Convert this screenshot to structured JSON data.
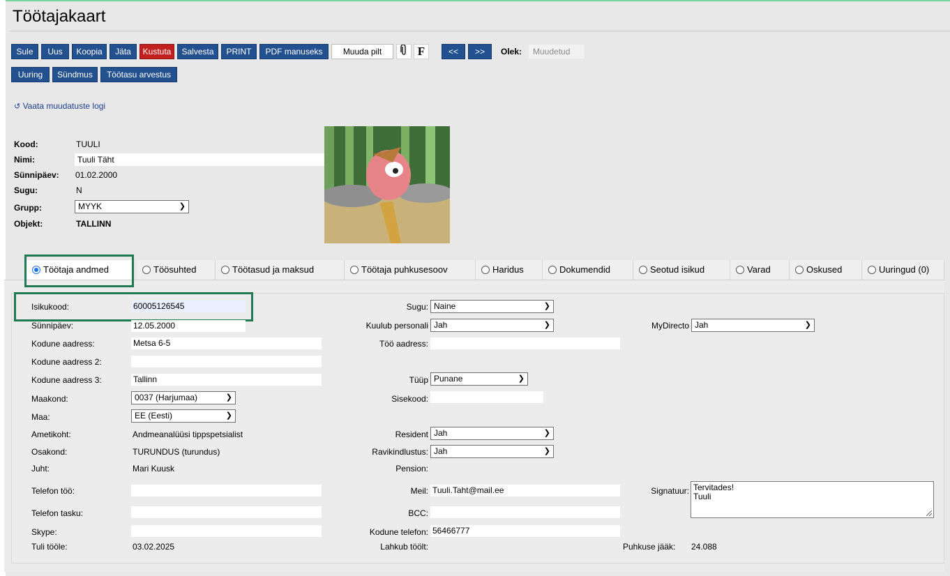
{
  "page": {
    "title": "Töötajakaart"
  },
  "toolbar": {
    "row1": [
      "Sule",
      "Uus",
      "Koopia",
      "Jäta",
      "Kustuta",
      "Salvesta",
      "PRINT",
      "PDF manuseks",
      "Muuda pilt"
    ],
    "f_label": "F",
    "prev": "<<",
    "next": ">>",
    "status_label": "Olek:",
    "status_value": "Muudetud",
    "row2": [
      "Uuring",
      "Sündmus",
      "Töötasu arvestus"
    ]
  },
  "log_link": "Vaata muudatuste logi",
  "header": {
    "kood_label": "Kood:",
    "kood_value": "TUULI",
    "nimi_label": "Nimi:",
    "nimi_value": "Tuuli Täht",
    "synnipaev_label": "Sünnipäev:",
    "synnipaev_value": "01.02.2000",
    "sugu_label": "Sugu:",
    "sugu_value": "N",
    "grupp_label": "Grupp:",
    "grupp_value": "MYYK",
    "objekt_label": "Objekt:",
    "objekt_value": "TALLINN"
  },
  "tabs": [
    "Töötaja andmed",
    "Töösuhted",
    "Töötasud ja maksud",
    "Töötaja puhkusesoov",
    "Haridus",
    "Dokumendid",
    "Seotud isikud",
    "Varad",
    "Oskused",
    "Uuringud (0)"
  ],
  "active_tab": "Töötaja andmed",
  "left": {
    "isikukood_label": "Isikukood:",
    "isikukood_value": "60005126545",
    "synnipaev_label": "Sünnipäev:",
    "synnipaev_value": "12.05.2000",
    "aadress_label": "Kodune aadress:",
    "aadress_value": "Metsa 6-5",
    "aadress2_label": "Kodune aadress 2:",
    "aadress2_value": "",
    "aadress3_label": "Kodune aadress 3:",
    "aadress3_value": "Tallinn",
    "maakond_label": "Maakond:",
    "maakond_value": "0037 (Harjumaa)",
    "maa_label": "Maa:",
    "maa_value": "EE (Eesti)",
    "ametikoht_label": "Ametikoht:",
    "ametikoht_value": "Andmeanalüüsi tippspetsialist",
    "osakond_label": "Osakond:",
    "osakond_value": "TURUNDUS (turundus)",
    "juht_label": "Juht:",
    "juht_value": "Mari Kuusk",
    "telefon_too_label": "Telefon töö:",
    "telefon_too_value": "",
    "telefon_tasku_label": "Telefon tasku:",
    "telefon_tasku_value": "",
    "skype_label": "Skype:",
    "skype_value": "",
    "tuli_label": "Tuli tööle:",
    "tuli_value": "03.02.2025"
  },
  "middle": {
    "sugu_label": "Sugu:",
    "sugu_value": "Naine",
    "personal_label": "Kuulub personali",
    "personal_value": "Jah",
    "too_aadress_label": "Töö aadress:",
    "too_aadress_value": "",
    "tyyp_label": "Tüüp",
    "tyyp_value": "Punane",
    "sisekood_label": "Sisekood:",
    "sisekood_value": "",
    "resident_label": "Resident",
    "resident_value": "Jah",
    "ravi_label": "Ravikindlustus:",
    "ravi_value": "Jah",
    "pension_label": "Pension:",
    "meil_label": "Meil:",
    "meil_value": "Tuuli.Taht@mail.ee",
    "bcc_label": "BCC:",
    "bcc_value": "",
    "kodune_tel_label": "Kodune telefon:",
    "kodune_tel_value": "56466777",
    "lahkub_label": "Lahkub töölt:"
  },
  "right": {
    "mydirecto_label": "MyDirecto",
    "mydirecto_value": "Jah",
    "signatuur_label": "Signatuur:",
    "signatuur_line1": "Tervitades!",
    "signatuur_line2": "Tuuli",
    "puhkus_label": "Puhkuse jääk:",
    "puhkus_value": "24.088"
  },
  "colors": {
    "button": "#23508e",
    "delete_button": "#c41f1f",
    "highlight_box": "#1f7a52"
  }
}
